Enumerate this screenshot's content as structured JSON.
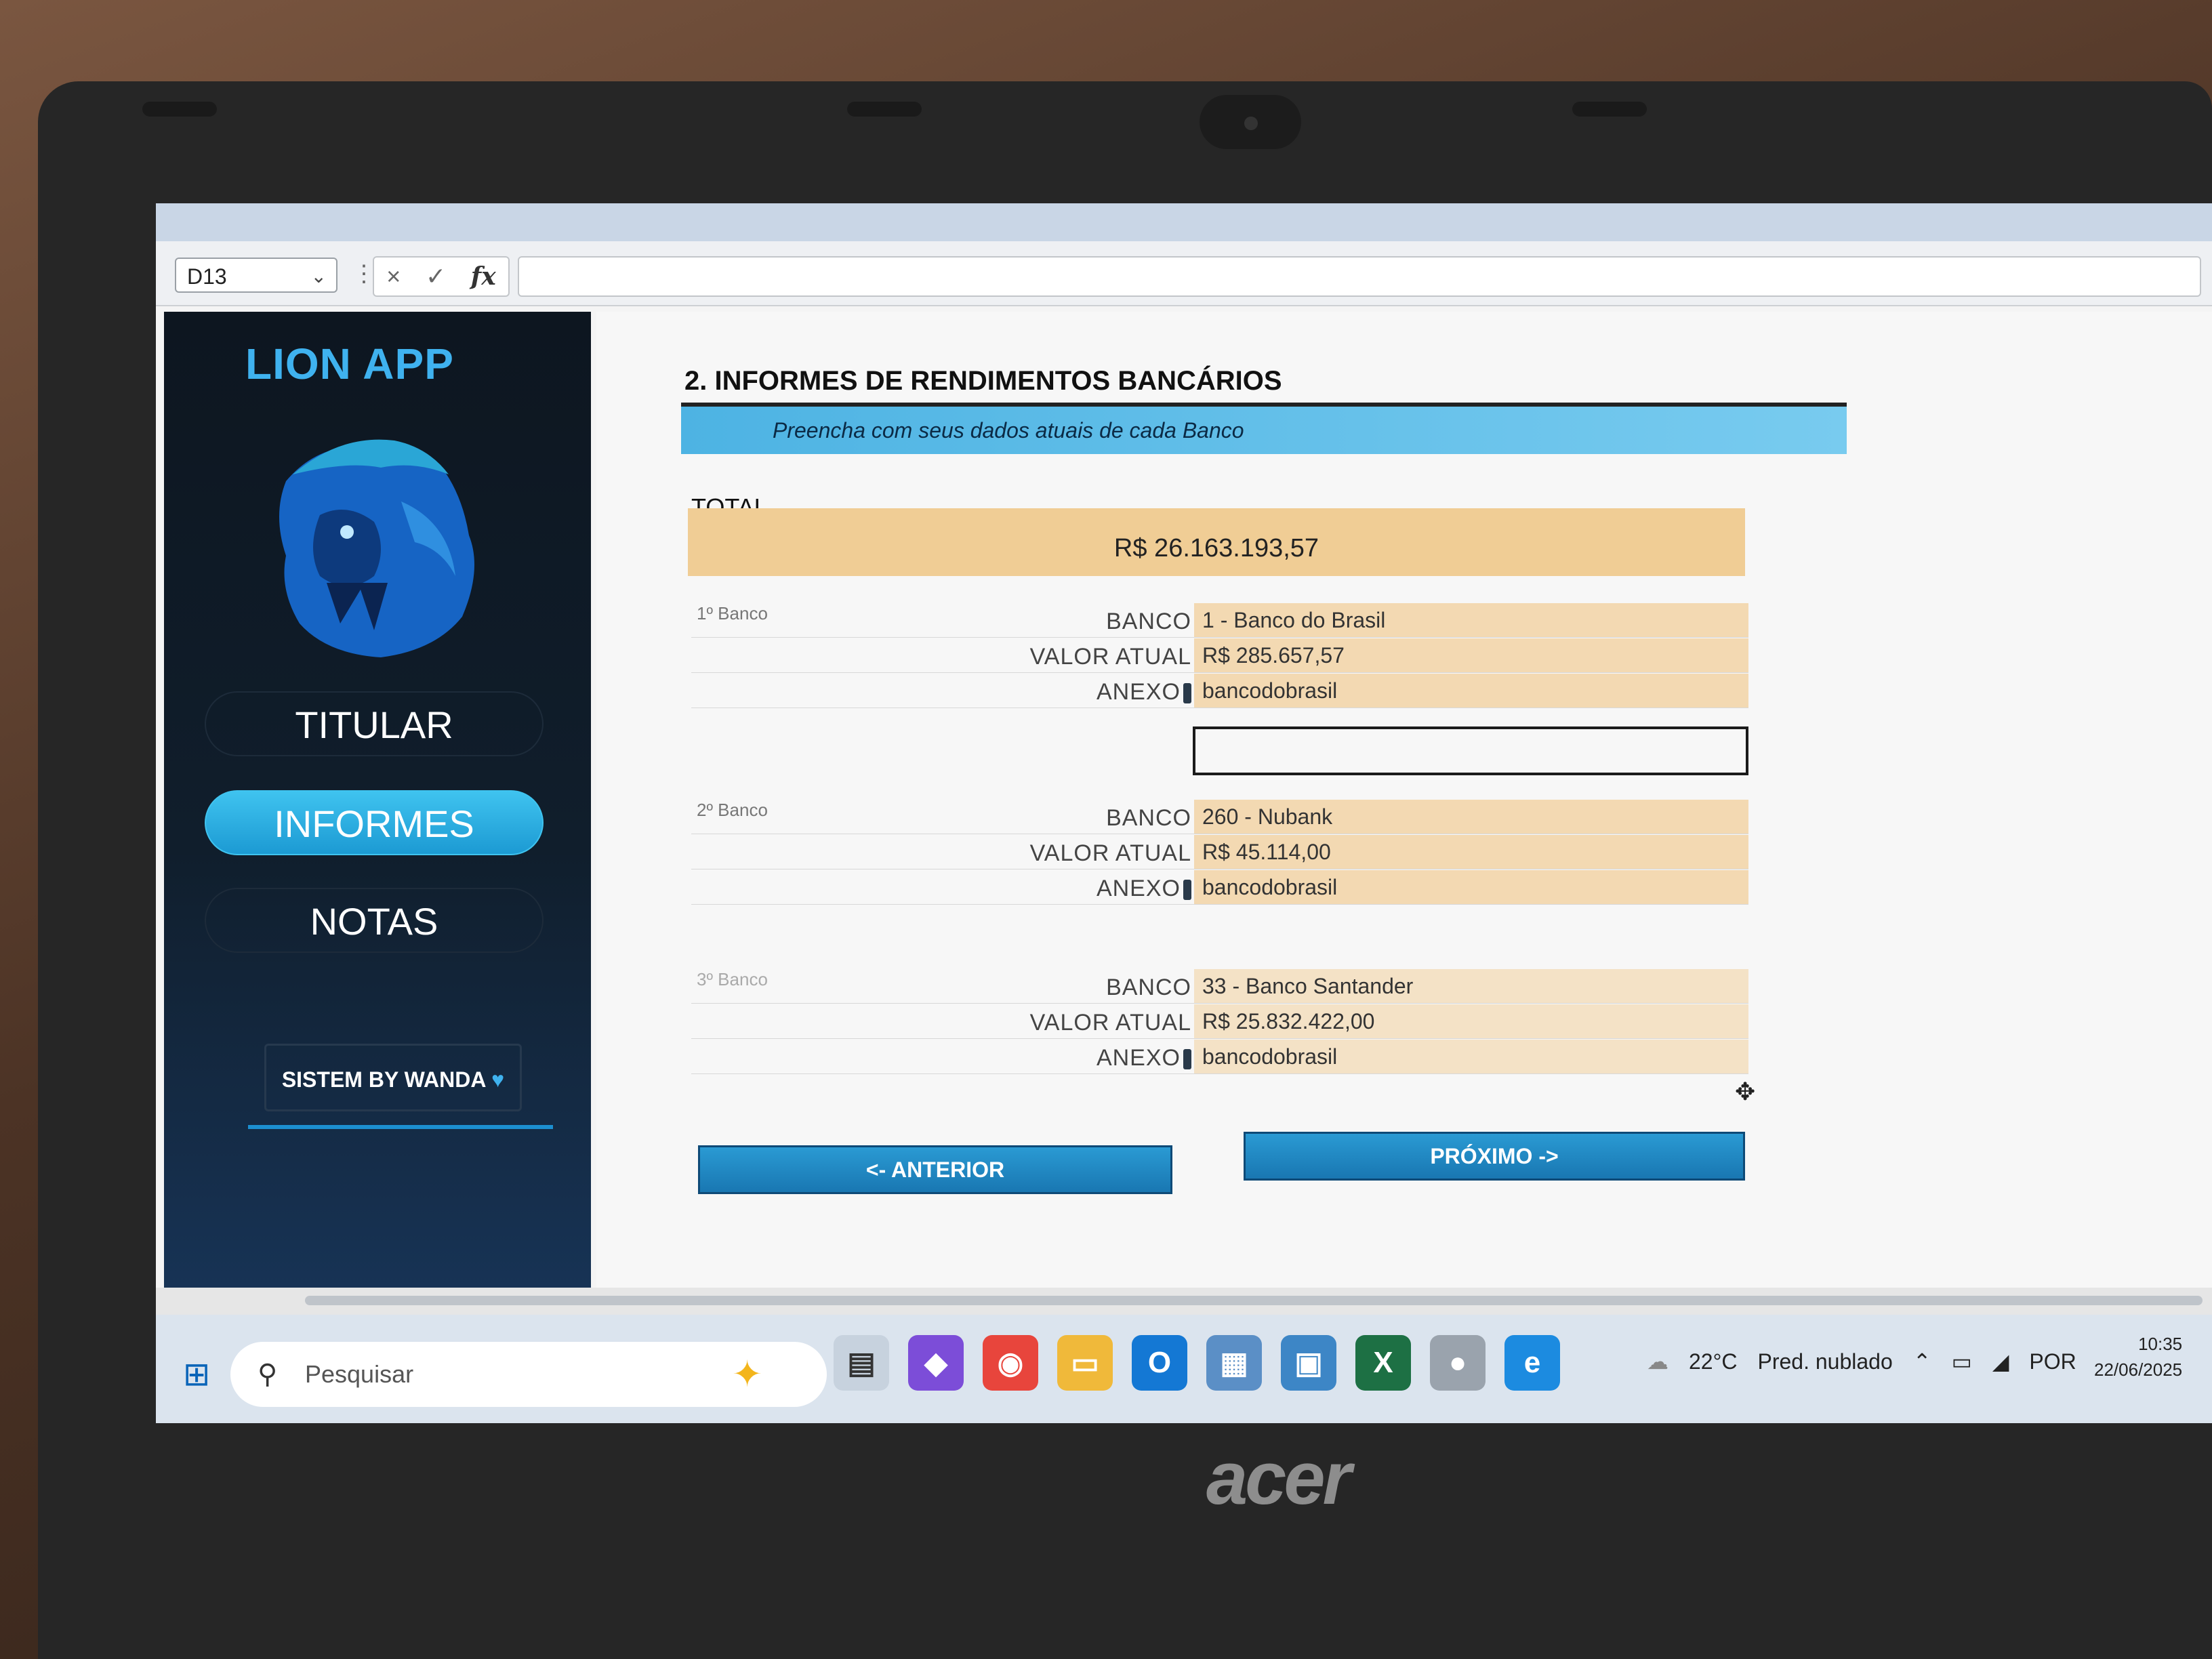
{
  "formula_bar": {
    "name_box": "D13",
    "cancel_icon": "×",
    "enter_icon": "✓",
    "fx_label": "fx"
  },
  "sidebar": {
    "app_title": "LION APP",
    "nav": [
      {
        "label": "TITULAR",
        "active": false
      },
      {
        "label": "INFORMES",
        "active": true
      },
      {
        "label": "NOTAS",
        "active": false
      }
    ],
    "credit": "SISTEM BY WANDA",
    "credit_icon": "heart-icon"
  },
  "main": {
    "section_title": "2. INFORMES DE RENDIMENTOS BANCÁRIOS",
    "subtitle": "Preencha com seus dados atuais de cada Banco",
    "total_label": "TOTAL",
    "total_value": "R$ 26.163.193,57",
    "row_labels": {
      "bank": "BANCO",
      "value": "VALOR ATUAL",
      "attachment": "ANEXO"
    },
    "banks": [
      {
        "label": "1º Banco",
        "bank": "1 - Banco do Brasil",
        "value": "R$ 285.657,57",
        "attachment": "bancodobrasil"
      },
      {
        "label": "2º Banco",
        "bank": "260 - Nubank",
        "value": "R$ 45.114,00",
        "attachment": "bancodobrasil"
      },
      {
        "label": "3º Banco",
        "bank": "33 - Banco Santander",
        "value": "R$ 25.832.422,00",
        "attachment": "bancodobrasil"
      }
    ],
    "prev_button": "<- ANTERIOR",
    "next_button": "PRÓXIMO ->"
  },
  "taskbar": {
    "search_placeholder": "Pesquisar",
    "weather": "22°C",
    "weather_desc": "Pred. nublado",
    "language": "POR",
    "time": "10:35",
    "date": "22/06/2025"
  },
  "device": {
    "brand": "acer"
  },
  "colors": {
    "accent": "#2a9ad3",
    "sidebar_bg": "#101e2c",
    "field_bg": "#f3d9b2",
    "total_bg": "#f0cd95"
  }
}
